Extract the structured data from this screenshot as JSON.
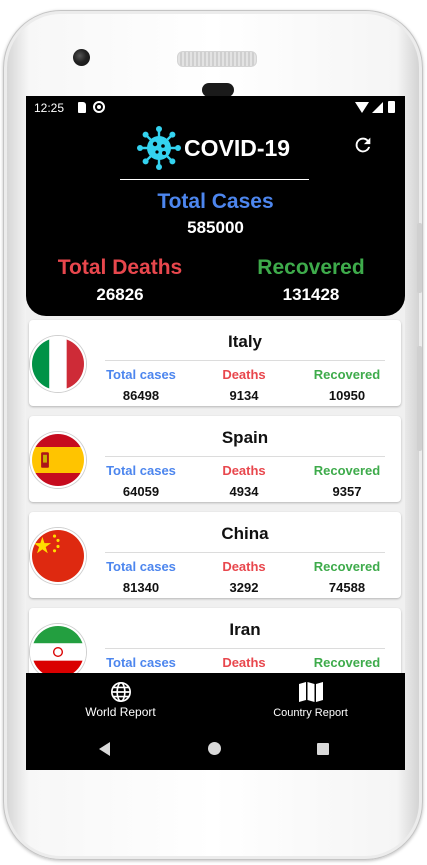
{
  "status_bar": {
    "time": "12:25"
  },
  "header": {
    "app_title": "COVID-19",
    "total_cases_label": "Total Cases",
    "total_cases_value": "585000",
    "total_deaths_label": "Total Deaths",
    "total_deaths_value": "26826",
    "recovered_label": "Recovered",
    "recovered_value": "131428",
    "logo_icon": "virus-icon",
    "refresh_icon": "refresh-icon"
  },
  "colors": {
    "cases": "#4d86ee",
    "deaths": "#e8474d",
    "recovered": "#3eab4b",
    "background": "#000000"
  },
  "countries": [
    {
      "name": "Italy",
      "flag_icon": "italy-flag-icon",
      "cases_label": "Total cases",
      "cases": "86498",
      "deaths_label": "Deaths",
      "deaths": "9134",
      "recovered_label": "Recovered",
      "recovered": "10950"
    },
    {
      "name": "Spain",
      "flag_icon": "spain-flag-icon",
      "cases_label": "Total cases",
      "cases": "64059",
      "deaths_label": "Deaths",
      "deaths": "4934",
      "recovered_label": "Recovered",
      "recovered": "9357"
    },
    {
      "name": "China",
      "flag_icon": "china-flag-icon",
      "cases_label": "Total cases",
      "cases": "81340",
      "deaths_label": "Deaths",
      "deaths": "3292",
      "recovered_label": "Recovered",
      "recovered": "74588"
    },
    {
      "name": "Iran",
      "flag_icon": "iran-flag-icon",
      "cases_label": "Total cases",
      "cases": "",
      "deaths_label": "Deaths",
      "deaths": "",
      "recovered_label": "Recovered",
      "recovered": ""
    }
  ],
  "bottom_nav": {
    "world_label": "World Report",
    "world_icon": "globe-icon",
    "country_label": "Country Report",
    "country_icon": "map-icon"
  },
  "system_nav": {
    "back_icon": "back-icon",
    "home_icon": "home-icon",
    "recent_icon": "recent-apps-icon"
  }
}
